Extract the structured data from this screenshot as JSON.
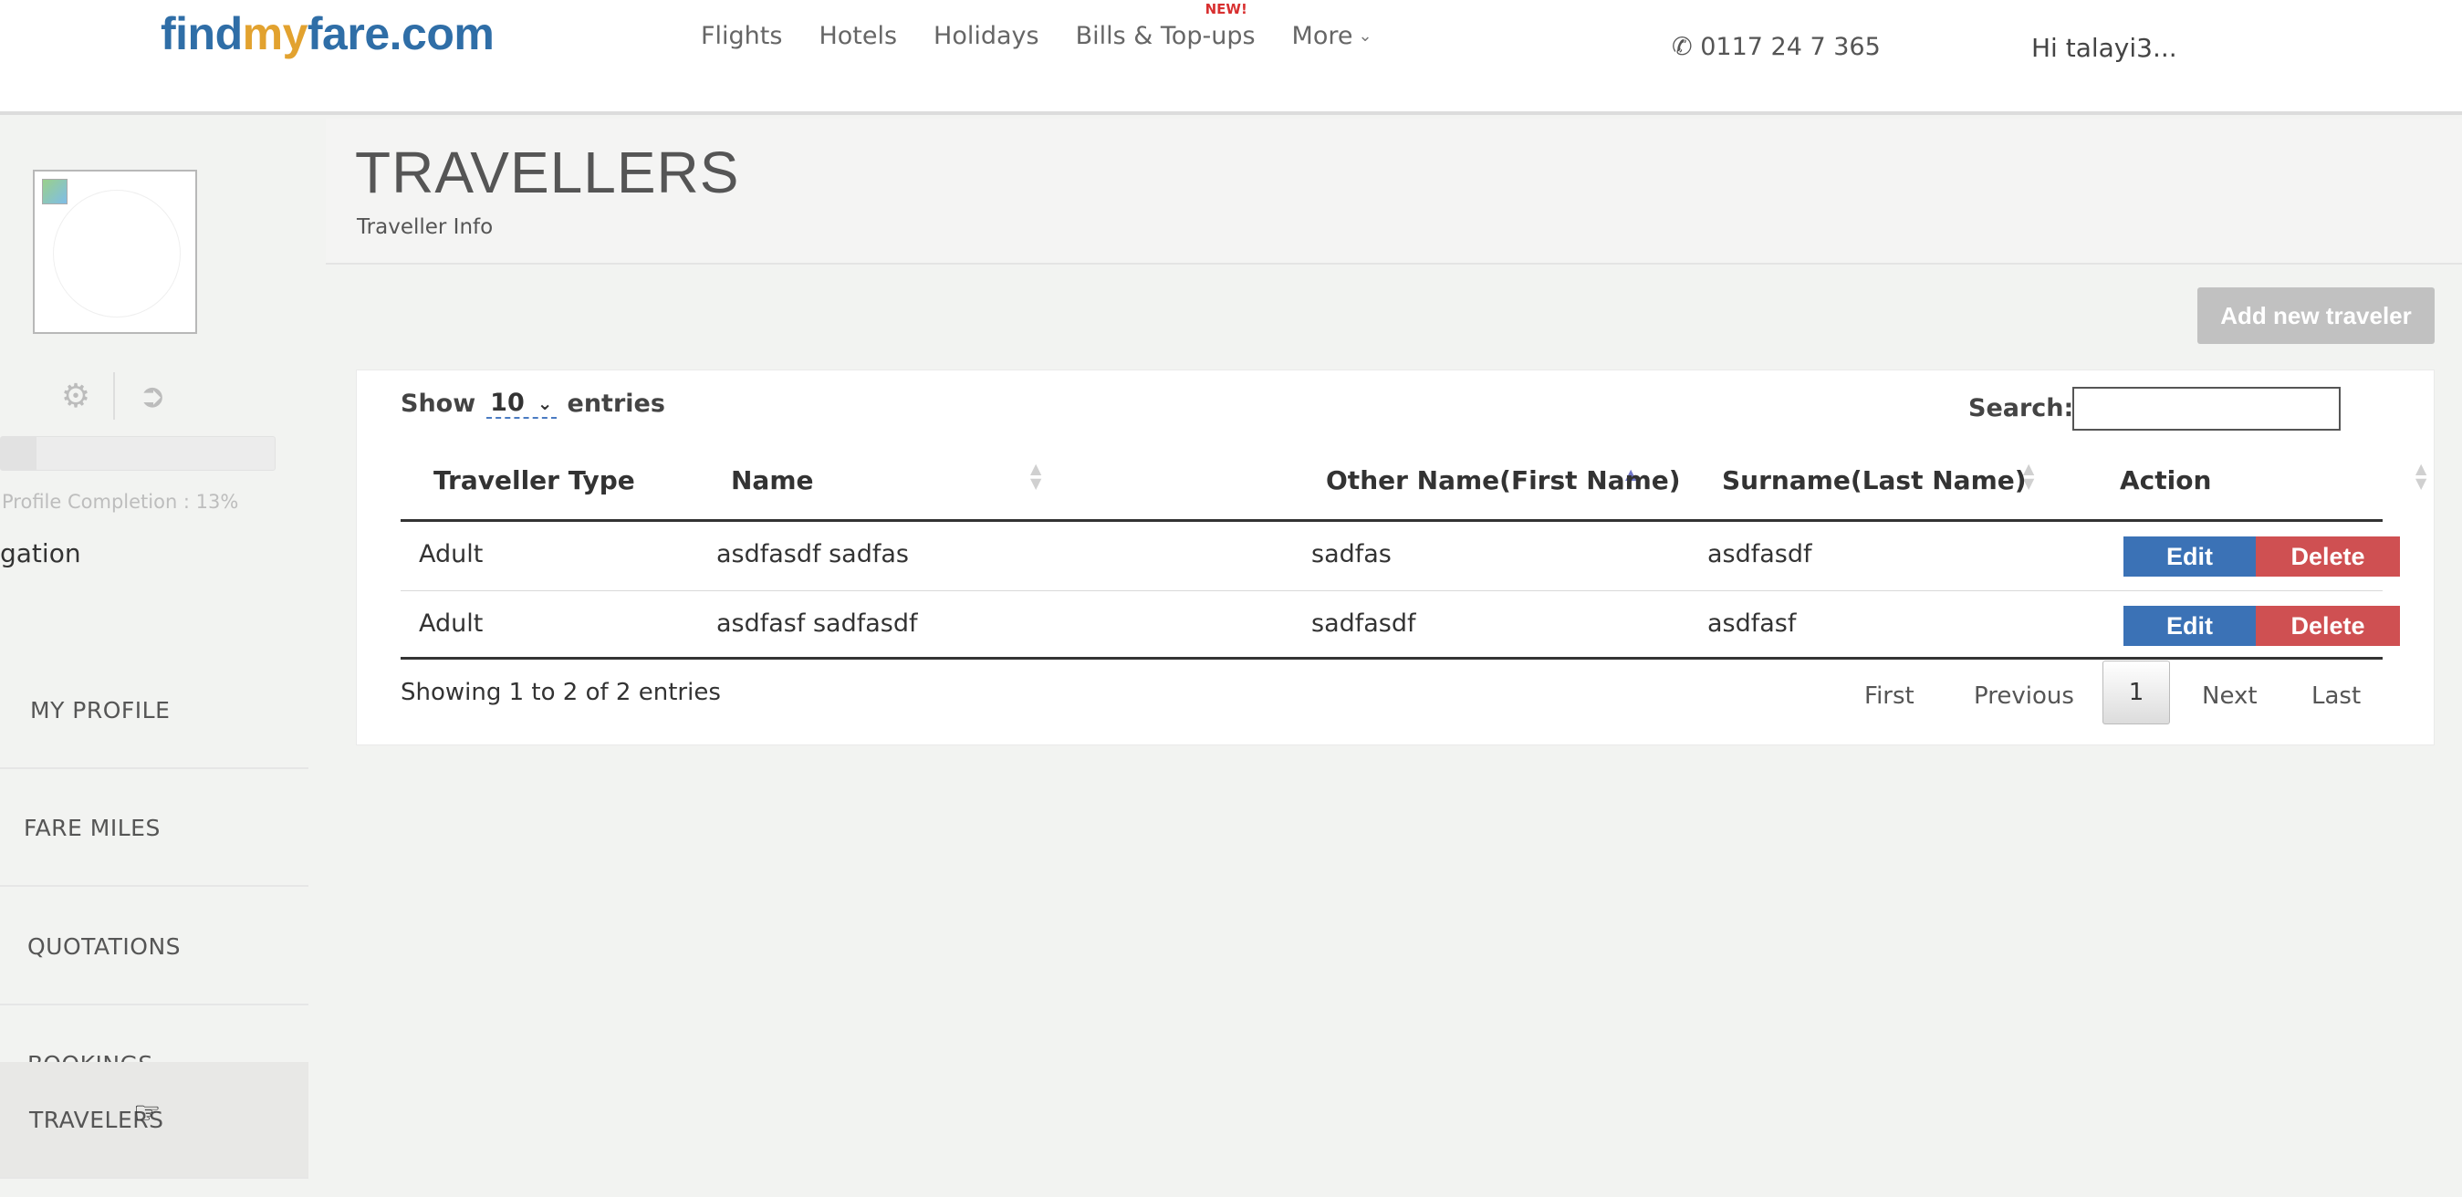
{
  "header": {
    "logo": {
      "part1": "find",
      "part2": "my",
      "part3": "fare.com"
    },
    "nav": [
      {
        "label": "Flights"
      },
      {
        "label": "Hotels"
      },
      {
        "label": "Holidays"
      },
      {
        "label": "Bills & Top-ups",
        "badge": "NEW!"
      },
      {
        "label": "More"
      }
    ],
    "phone": "0117 24 7 365",
    "greeting": "Hi talayi3..."
  },
  "sidebar": {
    "profile_completion": "Profile Completion : 13%",
    "profile_completion_value": 0.13,
    "nav_heading": "gation",
    "items": [
      {
        "label": "MY PROFILE"
      },
      {
        "label": "FARE MILES"
      },
      {
        "label": "QUOTATIONS"
      },
      {
        "label": "BOOKINGS"
      },
      {
        "label": "TRAVELERS",
        "active": true
      }
    ],
    "icons": [
      "gears-icon",
      "sign-out-icon"
    ]
  },
  "main": {
    "title": "TRAVELLERS",
    "subtitle": "Traveller Info",
    "add_button": "Add new traveler",
    "show_label": "Show",
    "entries_value": "10",
    "entries_label": "entries",
    "search_label": "Search:",
    "search_value": "",
    "columns": [
      "Traveller Type",
      "Name",
      "Other Name(First Name)",
      "Surname(Last Name)",
      "Action"
    ],
    "rows": [
      {
        "type": "Adult",
        "name": "asdfasdf sadfas",
        "other_name": "sadfas",
        "surname": "asdfasdf",
        "edit": "Edit",
        "delete": "Delete"
      },
      {
        "type": "Adult",
        "name": "asdfasf sadfasdf",
        "other_name": "sadfasdf",
        "surname": "asdfasf",
        "edit": "Edit",
        "delete": "Delete"
      }
    ],
    "info": "Showing 1 to 2 of 2 entries",
    "pagination": {
      "first": "First",
      "previous": "Previous",
      "current": "1",
      "next": "Next",
      "last": "Last"
    }
  },
  "colors": {
    "brand_blue": "#2f6ea7",
    "brand_orange": "#e2a22f",
    "edit_button": "#3b72b6",
    "delete_button": "#cf5052",
    "add_button": "#c1c1c1"
  }
}
